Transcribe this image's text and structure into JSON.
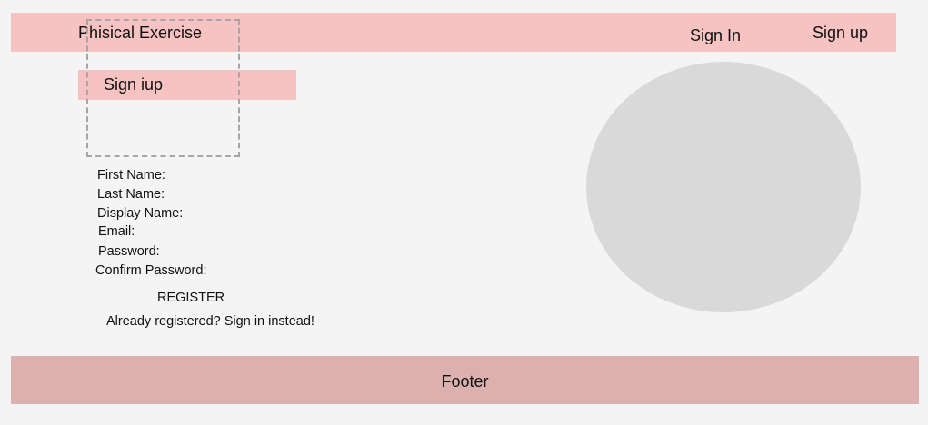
{
  "header": {
    "brand": "Phisical Exercise",
    "nav": {
      "sign_in": "Sign In",
      "sign_up": "Sign up"
    },
    "colors": {
      "background": "#f7c2c2"
    }
  },
  "main": {
    "page_title": "Sign iup",
    "form": {
      "fields": [
        "First Name:",
        "Last Name:",
        "Display Name:",
        "Email:",
        "Password:",
        "Confirm Password:"
      ],
      "register_label": "REGISTER",
      "signin_prompt": "Already registered? Sign in instead!"
    },
    "image_placeholder_color": "#d9d9d9"
  },
  "footer": {
    "text": "Footer",
    "background": "#ddb0b0"
  },
  "colors": {
    "page_background": "#f4f4f4",
    "placeholder_border": "#a6a6a6"
  }
}
